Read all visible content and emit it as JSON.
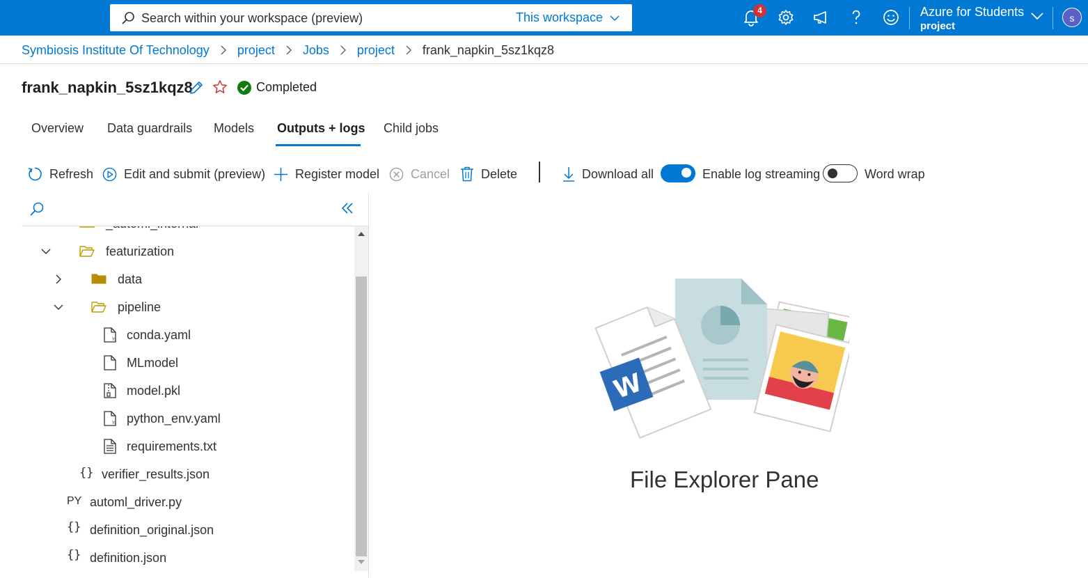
{
  "header": {
    "search_placeholder": "Search within your workspace (preview)",
    "search_scope": "This workspace",
    "notification_count": "4",
    "account_name": "Azure for Students",
    "account_sub": "project",
    "avatar_initial": "s",
    "colors": {
      "bar": "#0078d4",
      "badge": "#d13438"
    }
  },
  "breadcrumb": {
    "items": [
      "Symbiosis Institute Of Technology",
      "project",
      "Jobs",
      "project"
    ],
    "current": "frank_napkin_5sz1kqz8"
  },
  "job": {
    "title": "frank_napkin_5sz1kqz8",
    "status": "Completed",
    "status_color": "#107c10"
  },
  "tabs": [
    "Overview",
    "Data guardrails",
    "Models",
    "Outputs + logs",
    "Child jobs"
  ],
  "active_tab": "Outputs + logs",
  "toolbar": {
    "refresh": "Refresh",
    "edit_submit": "Edit and submit (preview)",
    "register_model": "Register model",
    "cancel": "Cancel",
    "delete": "Delete",
    "download_all": "Download all",
    "log_streaming": "Enable log streaming",
    "log_streaming_on": true,
    "word_wrap": "Word wrap",
    "word_wrap_on": false
  },
  "file_tree": [
    {
      "name": "_automl_internal",
      "type": "folder",
      "state": "collapsed",
      "partially_visible": true
    },
    {
      "name": "featurization",
      "type": "folder",
      "state": "expanded"
    },
    {
      "name": "data",
      "type": "folder",
      "state": "collapsed"
    },
    {
      "name": "pipeline",
      "type": "folder",
      "state": "expanded"
    },
    {
      "name": "conda.yaml",
      "type": "yaml"
    },
    {
      "name": "MLmodel",
      "type": "file"
    },
    {
      "name": "model.pkl",
      "type": "archive"
    },
    {
      "name": "python_env.yaml",
      "type": "yaml"
    },
    {
      "name": "requirements.txt",
      "type": "text"
    },
    {
      "name": "verifier_results.json",
      "type": "json"
    },
    {
      "name": "automl_driver.py",
      "type": "python",
      "icon_label": "PY"
    },
    {
      "name": "definition_original.json",
      "type": "json"
    },
    {
      "name": "definition.json",
      "type": "json"
    }
  ],
  "json_icon_label": "{}",
  "preview": {
    "caption": "File Explorer Pane"
  }
}
